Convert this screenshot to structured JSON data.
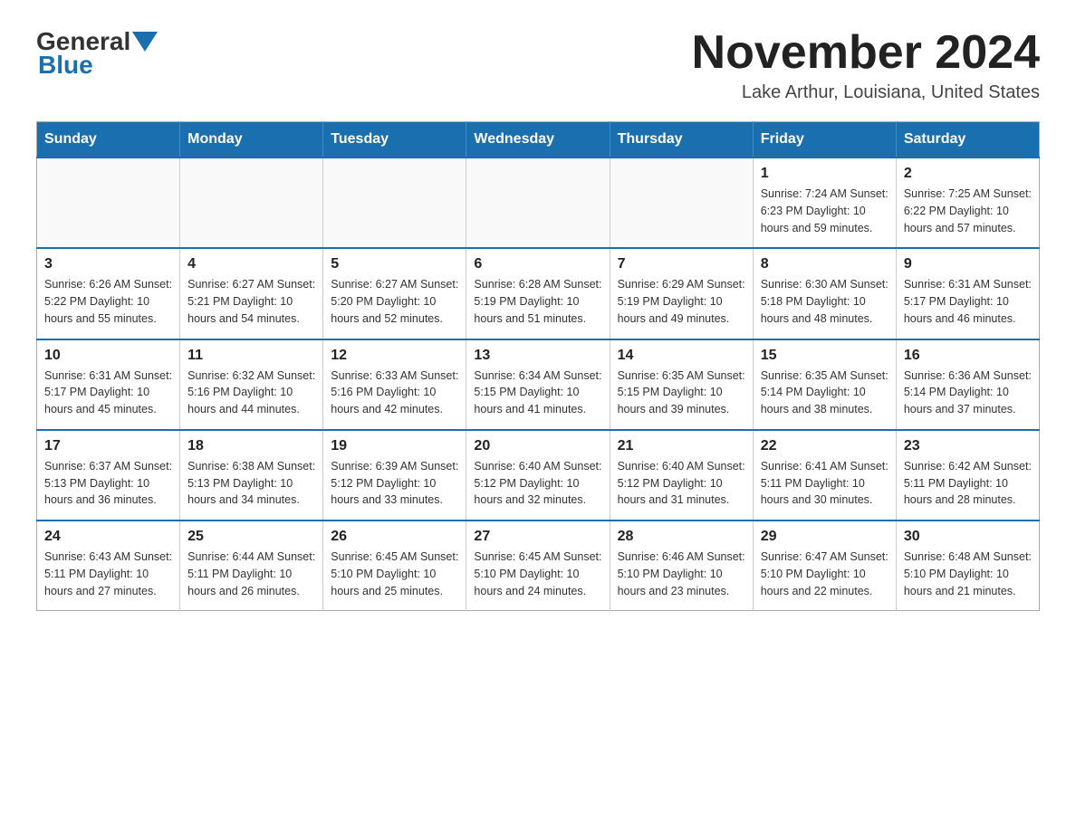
{
  "logo": {
    "general": "General",
    "blue": "Blue"
  },
  "title": "November 2024",
  "subtitle": "Lake Arthur, Louisiana, United States",
  "days_of_week": [
    "Sunday",
    "Monday",
    "Tuesday",
    "Wednesday",
    "Thursday",
    "Friday",
    "Saturday"
  ],
  "weeks": [
    [
      {
        "day": "",
        "info": ""
      },
      {
        "day": "",
        "info": ""
      },
      {
        "day": "",
        "info": ""
      },
      {
        "day": "",
        "info": ""
      },
      {
        "day": "",
        "info": ""
      },
      {
        "day": "1",
        "info": "Sunrise: 7:24 AM\nSunset: 6:23 PM\nDaylight: 10 hours and 59 minutes."
      },
      {
        "day": "2",
        "info": "Sunrise: 7:25 AM\nSunset: 6:22 PM\nDaylight: 10 hours and 57 minutes."
      }
    ],
    [
      {
        "day": "3",
        "info": "Sunrise: 6:26 AM\nSunset: 5:22 PM\nDaylight: 10 hours and 55 minutes."
      },
      {
        "day": "4",
        "info": "Sunrise: 6:27 AM\nSunset: 5:21 PM\nDaylight: 10 hours and 54 minutes."
      },
      {
        "day": "5",
        "info": "Sunrise: 6:27 AM\nSunset: 5:20 PM\nDaylight: 10 hours and 52 minutes."
      },
      {
        "day": "6",
        "info": "Sunrise: 6:28 AM\nSunset: 5:19 PM\nDaylight: 10 hours and 51 minutes."
      },
      {
        "day": "7",
        "info": "Sunrise: 6:29 AM\nSunset: 5:19 PM\nDaylight: 10 hours and 49 minutes."
      },
      {
        "day": "8",
        "info": "Sunrise: 6:30 AM\nSunset: 5:18 PM\nDaylight: 10 hours and 48 minutes."
      },
      {
        "day": "9",
        "info": "Sunrise: 6:31 AM\nSunset: 5:17 PM\nDaylight: 10 hours and 46 minutes."
      }
    ],
    [
      {
        "day": "10",
        "info": "Sunrise: 6:31 AM\nSunset: 5:17 PM\nDaylight: 10 hours and 45 minutes."
      },
      {
        "day": "11",
        "info": "Sunrise: 6:32 AM\nSunset: 5:16 PM\nDaylight: 10 hours and 44 minutes."
      },
      {
        "day": "12",
        "info": "Sunrise: 6:33 AM\nSunset: 5:16 PM\nDaylight: 10 hours and 42 minutes."
      },
      {
        "day": "13",
        "info": "Sunrise: 6:34 AM\nSunset: 5:15 PM\nDaylight: 10 hours and 41 minutes."
      },
      {
        "day": "14",
        "info": "Sunrise: 6:35 AM\nSunset: 5:15 PM\nDaylight: 10 hours and 39 minutes."
      },
      {
        "day": "15",
        "info": "Sunrise: 6:35 AM\nSunset: 5:14 PM\nDaylight: 10 hours and 38 minutes."
      },
      {
        "day": "16",
        "info": "Sunrise: 6:36 AM\nSunset: 5:14 PM\nDaylight: 10 hours and 37 minutes."
      }
    ],
    [
      {
        "day": "17",
        "info": "Sunrise: 6:37 AM\nSunset: 5:13 PM\nDaylight: 10 hours and 36 minutes."
      },
      {
        "day": "18",
        "info": "Sunrise: 6:38 AM\nSunset: 5:13 PM\nDaylight: 10 hours and 34 minutes."
      },
      {
        "day": "19",
        "info": "Sunrise: 6:39 AM\nSunset: 5:12 PM\nDaylight: 10 hours and 33 minutes."
      },
      {
        "day": "20",
        "info": "Sunrise: 6:40 AM\nSunset: 5:12 PM\nDaylight: 10 hours and 32 minutes."
      },
      {
        "day": "21",
        "info": "Sunrise: 6:40 AM\nSunset: 5:12 PM\nDaylight: 10 hours and 31 minutes."
      },
      {
        "day": "22",
        "info": "Sunrise: 6:41 AM\nSunset: 5:11 PM\nDaylight: 10 hours and 30 minutes."
      },
      {
        "day": "23",
        "info": "Sunrise: 6:42 AM\nSunset: 5:11 PM\nDaylight: 10 hours and 28 minutes."
      }
    ],
    [
      {
        "day": "24",
        "info": "Sunrise: 6:43 AM\nSunset: 5:11 PM\nDaylight: 10 hours and 27 minutes."
      },
      {
        "day": "25",
        "info": "Sunrise: 6:44 AM\nSunset: 5:11 PM\nDaylight: 10 hours and 26 minutes."
      },
      {
        "day": "26",
        "info": "Sunrise: 6:45 AM\nSunset: 5:10 PM\nDaylight: 10 hours and 25 minutes."
      },
      {
        "day": "27",
        "info": "Sunrise: 6:45 AM\nSunset: 5:10 PM\nDaylight: 10 hours and 24 minutes."
      },
      {
        "day": "28",
        "info": "Sunrise: 6:46 AM\nSunset: 5:10 PM\nDaylight: 10 hours and 23 minutes."
      },
      {
        "day": "29",
        "info": "Sunrise: 6:47 AM\nSunset: 5:10 PM\nDaylight: 10 hours and 22 minutes."
      },
      {
        "day": "30",
        "info": "Sunrise: 6:48 AM\nSunset: 5:10 PM\nDaylight: 10 hours and 21 minutes."
      }
    ]
  ],
  "colors": {
    "header_bg": "#1a6faf",
    "border": "#1a6faf",
    "logo_blue": "#1a6faf"
  }
}
